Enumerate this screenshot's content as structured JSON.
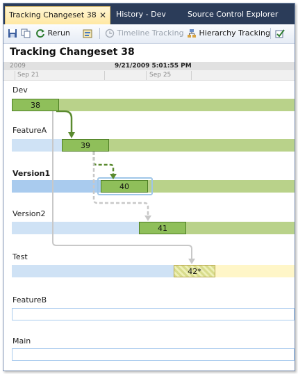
{
  "tabs": [
    {
      "label": "Tracking Changeset 38",
      "active": true,
      "close": "✕"
    },
    {
      "label": "History - Dev"
    },
    {
      "label": "Source Control Explorer"
    }
  ],
  "toolbar": {
    "rerun": "Rerun",
    "timeline_tracking": "Timeline Tracking",
    "hierarchy_tracking": "Hierarchy Tracking"
  },
  "page_title": "Tracking Changeset 38",
  "timeline": {
    "year": "2009",
    "current_date": "9/21/2009 5:01:55 PM",
    "days": [
      "Sep 21",
      "Sep 25"
    ]
  },
  "branches": [
    {
      "name": "Dev",
      "changeset": "38",
      "bold": false
    },
    {
      "name": "FeatureA",
      "changeset": "39",
      "bold": false
    },
    {
      "name": "Version1",
      "changeset": "40",
      "bold": true
    },
    {
      "name": "Version2",
      "changeset": "41",
      "bold": false
    },
    {
      "name": "Test",
      "changeset": "42*",
      "bold": false
    },
    {
      "name": "FeatureB",
      "changeset": "",
      "bold": false
    },
    {
      "name": "Main",
      "changeset": "",
      "bold": false
    }
  ],
  "colors": {
    "tab_strip": "#2b3c59",
    "merged_green": "#b9d28a",
    "changeset_green": "#8fbf5a",
    "not_merged_blue": "#cfe2f5",
    "pending_yellow": "#fff6c8",
    "arrow_green": "#5a8a2f",
    "arrow_gray": "#c8c8c8"
  }
}
